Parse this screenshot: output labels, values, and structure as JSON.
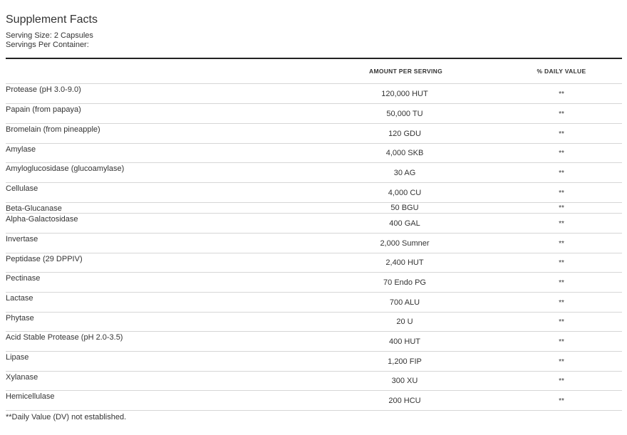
{
  "panel": {
    "title": "Supplement Facts",
    "serving_size": "Serving Size: 2 Capsules",
    "servings_per_container": "Servings Per Container:",
    "columns": {
      "amount": "AMOUNT PER SERVING",
      "daily_value": "% DAILY VALUE"
    },
    "rows": [
      {
        "name": "Protease (pH 3.0-9.0)",
        "amount": "120,000 HUT",
        "dv": "**"
      },
      {
        "name": "Papain (from papaya)",
        "amount": "50,000 TU",
        "dv": "**"
      },
      {
        "name": "Bromelain (from pineapple)",
        "amount": "120 GDU",
        "dv": "**"
      },
      {
        "name": "Amylase",
        "amount": "4,000 SKB",
        "dv": "**"
      },
      {
        "name": "Amyloglucosidase (glucoamylase)",
        "amount": "30 AG",
        "dv": "**"
      },
      {
        "name": "Cellulase",
        "amount": "4,000 CU",
        "dv": "**"
      },
      {
        "name": "Beta-Glucanase",
        "amount": "50 BGU",
        "dv": "**"
      },
      {
        "name": "Alpha-Galactosidase",
        "amount": "400 GAL",
        "dv": "**"
      },
      {
        "name": "Invertase",
        "amount": "2,000 Sumner",
        "dv": "**"
      },
      {
        "name": "Peptidase (29 DPPIV)",
        "amount": "2,400 HUT",
        "dv": "**"
      },
      {
        "name": "Pectinase",
        "amount": "70 Endo PG",
        "dv": "**"
      },
      {
        "name": "Lactase",
        "amount": "700 ALU",
        "dv": "**"
      },
      {
        "name": "Phytase",
        "amount": "20 U",
        "dv": "**"
      },
      {
        "name": "Acid Stable Protease (pH 2.0-3.5)",
        "amount": "400 HUT",
        "dv": "**"
      },
      {
        "name": "Lipase",
        "amount": "1,200 FIP",
        "dv": "**"
      },
      {
        "name": "Xylanase",
        "amount": "300 XU",
        "dv": "**"
      },
      {
        "name": "Hemicellulase",
        "amount": "200 HCU",
        "dv": "**"
      }
    ],
    "footnote": "**Daily Value (DV) not established."
  }
}
